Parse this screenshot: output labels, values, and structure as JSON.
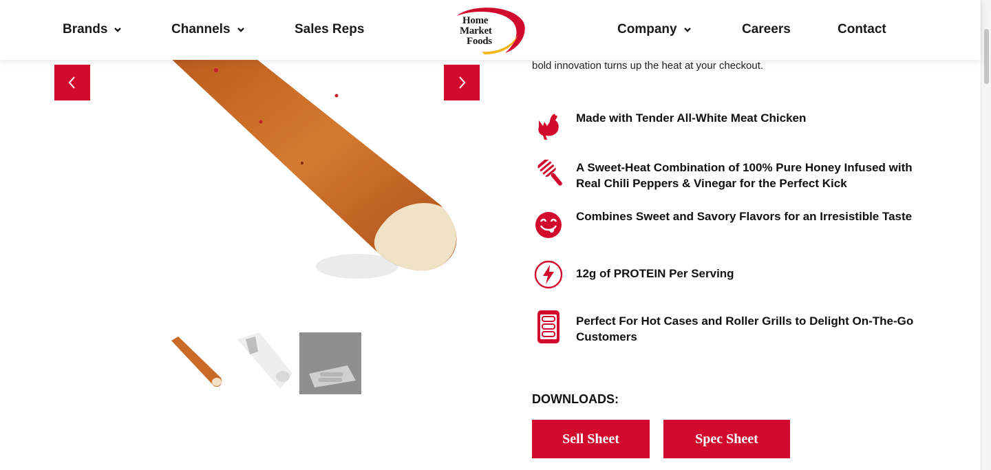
{
  "nav": {
    "brands": "Brands",
    "channels": "Channels",
    "sales_reps": "Sales Reps",
    "company": "Company",
    "careers": "Careers",
    "contact": "Contact"
  },
  "logo": {
    "line1": "Home",
    "line2": "Market",
    "line3": "Foods"
  },
  "product": {
    "intro_text": "bold innovation turns up the heat at your checkout."
  },
  "features": [
    {
      "icon": "chicken-icon",
      "text": "Made with Tender All-White Meat Chicken"
    },
    {
      "icon": "honey-dipper-icon",
      "text": "A Sweet-Heat Combination of 100% Pure Honey Infused with Real Chili Peppers & Vinegar for the Perfect Kick"
    },
    {
      "icon": "tongue-smile-icon",
      "text": "Combines Sweet and Savory Flavors for an Irresistible Taste"
    },
    {
      "icon": "lightning-icon",
      "text": "12g of PROTEIN Per Serving"
    },
    {
      "icon": "roller-grill-icon",
      "text": "Perfect For Hot Cases and Roller Grills to Delight On-The-Go Customers"
    }
  ],
  "downloads": {
    "title": "DOWNLOADS:",
    "sell_sheet": "Sell Sheet",
    "spec_sheet": "Spec Sheet"
  },
  "colors": {
    "brand_red": "#d20a2e",
    "logo_yellow": "#f2b418"
  }
}
